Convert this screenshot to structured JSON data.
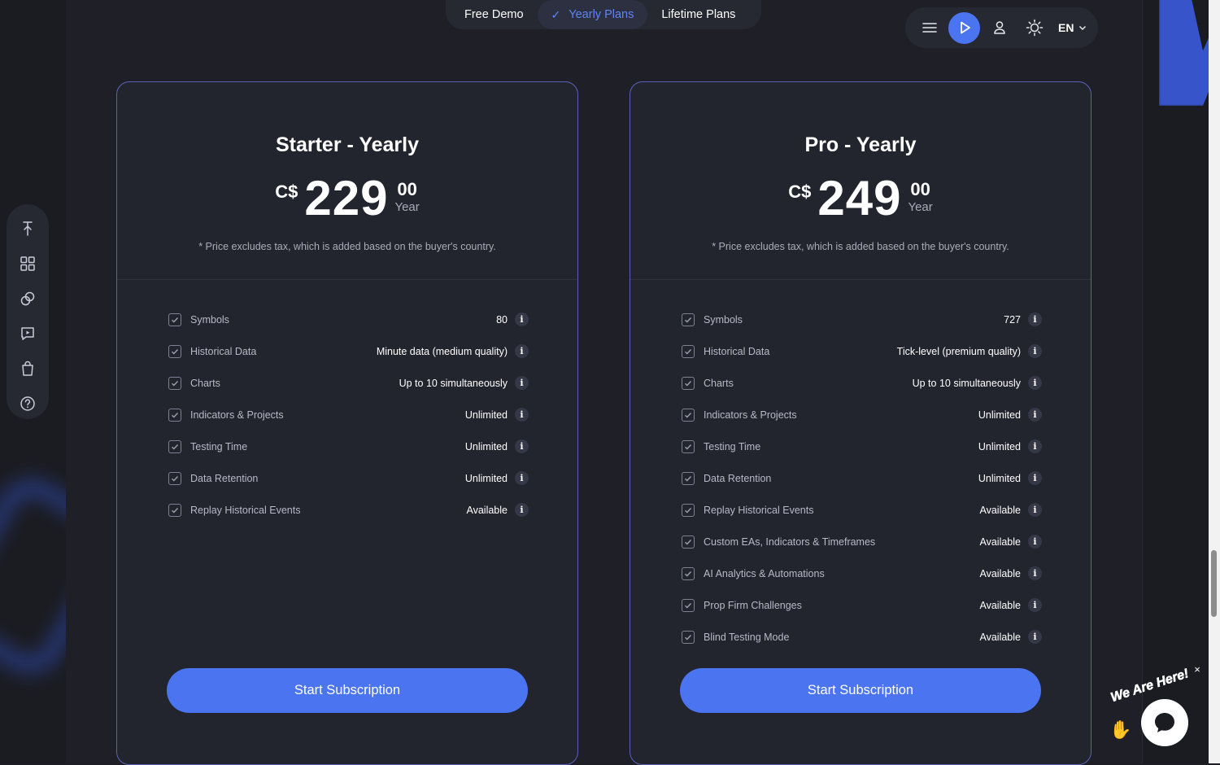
{
  "tabs": [
    {
      "label": "Free Demo",
      "active": false
    },
    {
      "label": "Yearly Plans",
      "active": true
    },
    {
      "label": "Lifetime Plans",
      "active": false
    }
  ],
  "toolbar": {
    "icons": [
      "menu-icon",
      "play-icon",
      "user-icon",
      "theme-sun-icon"
    ],
    "language": "EN",
    "accent_color": "#4a74f0"
  },
  "sidebar": {
    "icons": [
      "pin-icon",
      "grid-icon",
      "link-icon",
      "chat-video-icon",
      "shopping-bag-icon",
      "help-icon"
    ]
  },
  "plans": [
    {
      "title": "Starter - Yearly",
      "currency": "C$",
      "amount": "229",
      "cents": "00",
      "period": "Year",
      "tax_note": "* Price excludes tax, which is added based on the buyer's country.",
      "features": [
        {
          "name": "Symbols",
          "value": "80"
        },
        {
          "name": "Historical Data",
          "value": "Minute data (medium quality)"
        },
        {
          "name": "Charts",
          "value": "Up to 10 simultaneously"
        },
        {
          "name": "Indicators & Projects",
          "value": "Unlimited"
        },
        {
          "name": "Testing Time",
          "value": "Unlimited"
        },
        {
          "name": "Data Retention",
          "value": "Unlimited"
        },
        {
          "name": "Replay Historical Events",
          "value": "Available"
        }
      ],
      "cta": "Start Subscription"
    },
    {
      "title": "Pro - Yearly",
      "currency": "C$",
      "amount": "249",
      "cents": "00",
      "period": "Year",
      "tax_note": "* Price excludes tax, which is added based on the buyer's country.",
      "features": [
        {
          "name": "Symbols",
          "value": "727"
        },
        {
          "name": "Historical Data",
          "value": "Tick-level (premium quality)"
        },
        {
          "name": "Charts",
          "value": "Up to 10 simultaneously"
        },
        {
          "name": "Indicators & Projects",
          "value": "Unlimited"
        },
        {
          "name": "Testing Time",
          "value": "Unlimited"
        },
        {
          "name": "Data Retention",
          "value": "Unlimited"
        },
        {
          "name": "Replay Historical Events",
          "value": "Available"
        },
        {
          "name": "Custom EAs, Indicators & Timeframes",
          "value": "Available"
        },
        {
          "name": "AI Analytics & Automations",
          "value": "Available"
        },
        {
          "name": "Prop Firm Challenges",
          "value": "Available"
        },
        {
          "name": "Blind Testing Mode",
          "value": "Available"
        }
      ],
      "cta": "Start Subscription"
    }
  ],
  "chat_widget": {
    "tagline": "We Are Here!",
    "close_label": "×"
  }
}
